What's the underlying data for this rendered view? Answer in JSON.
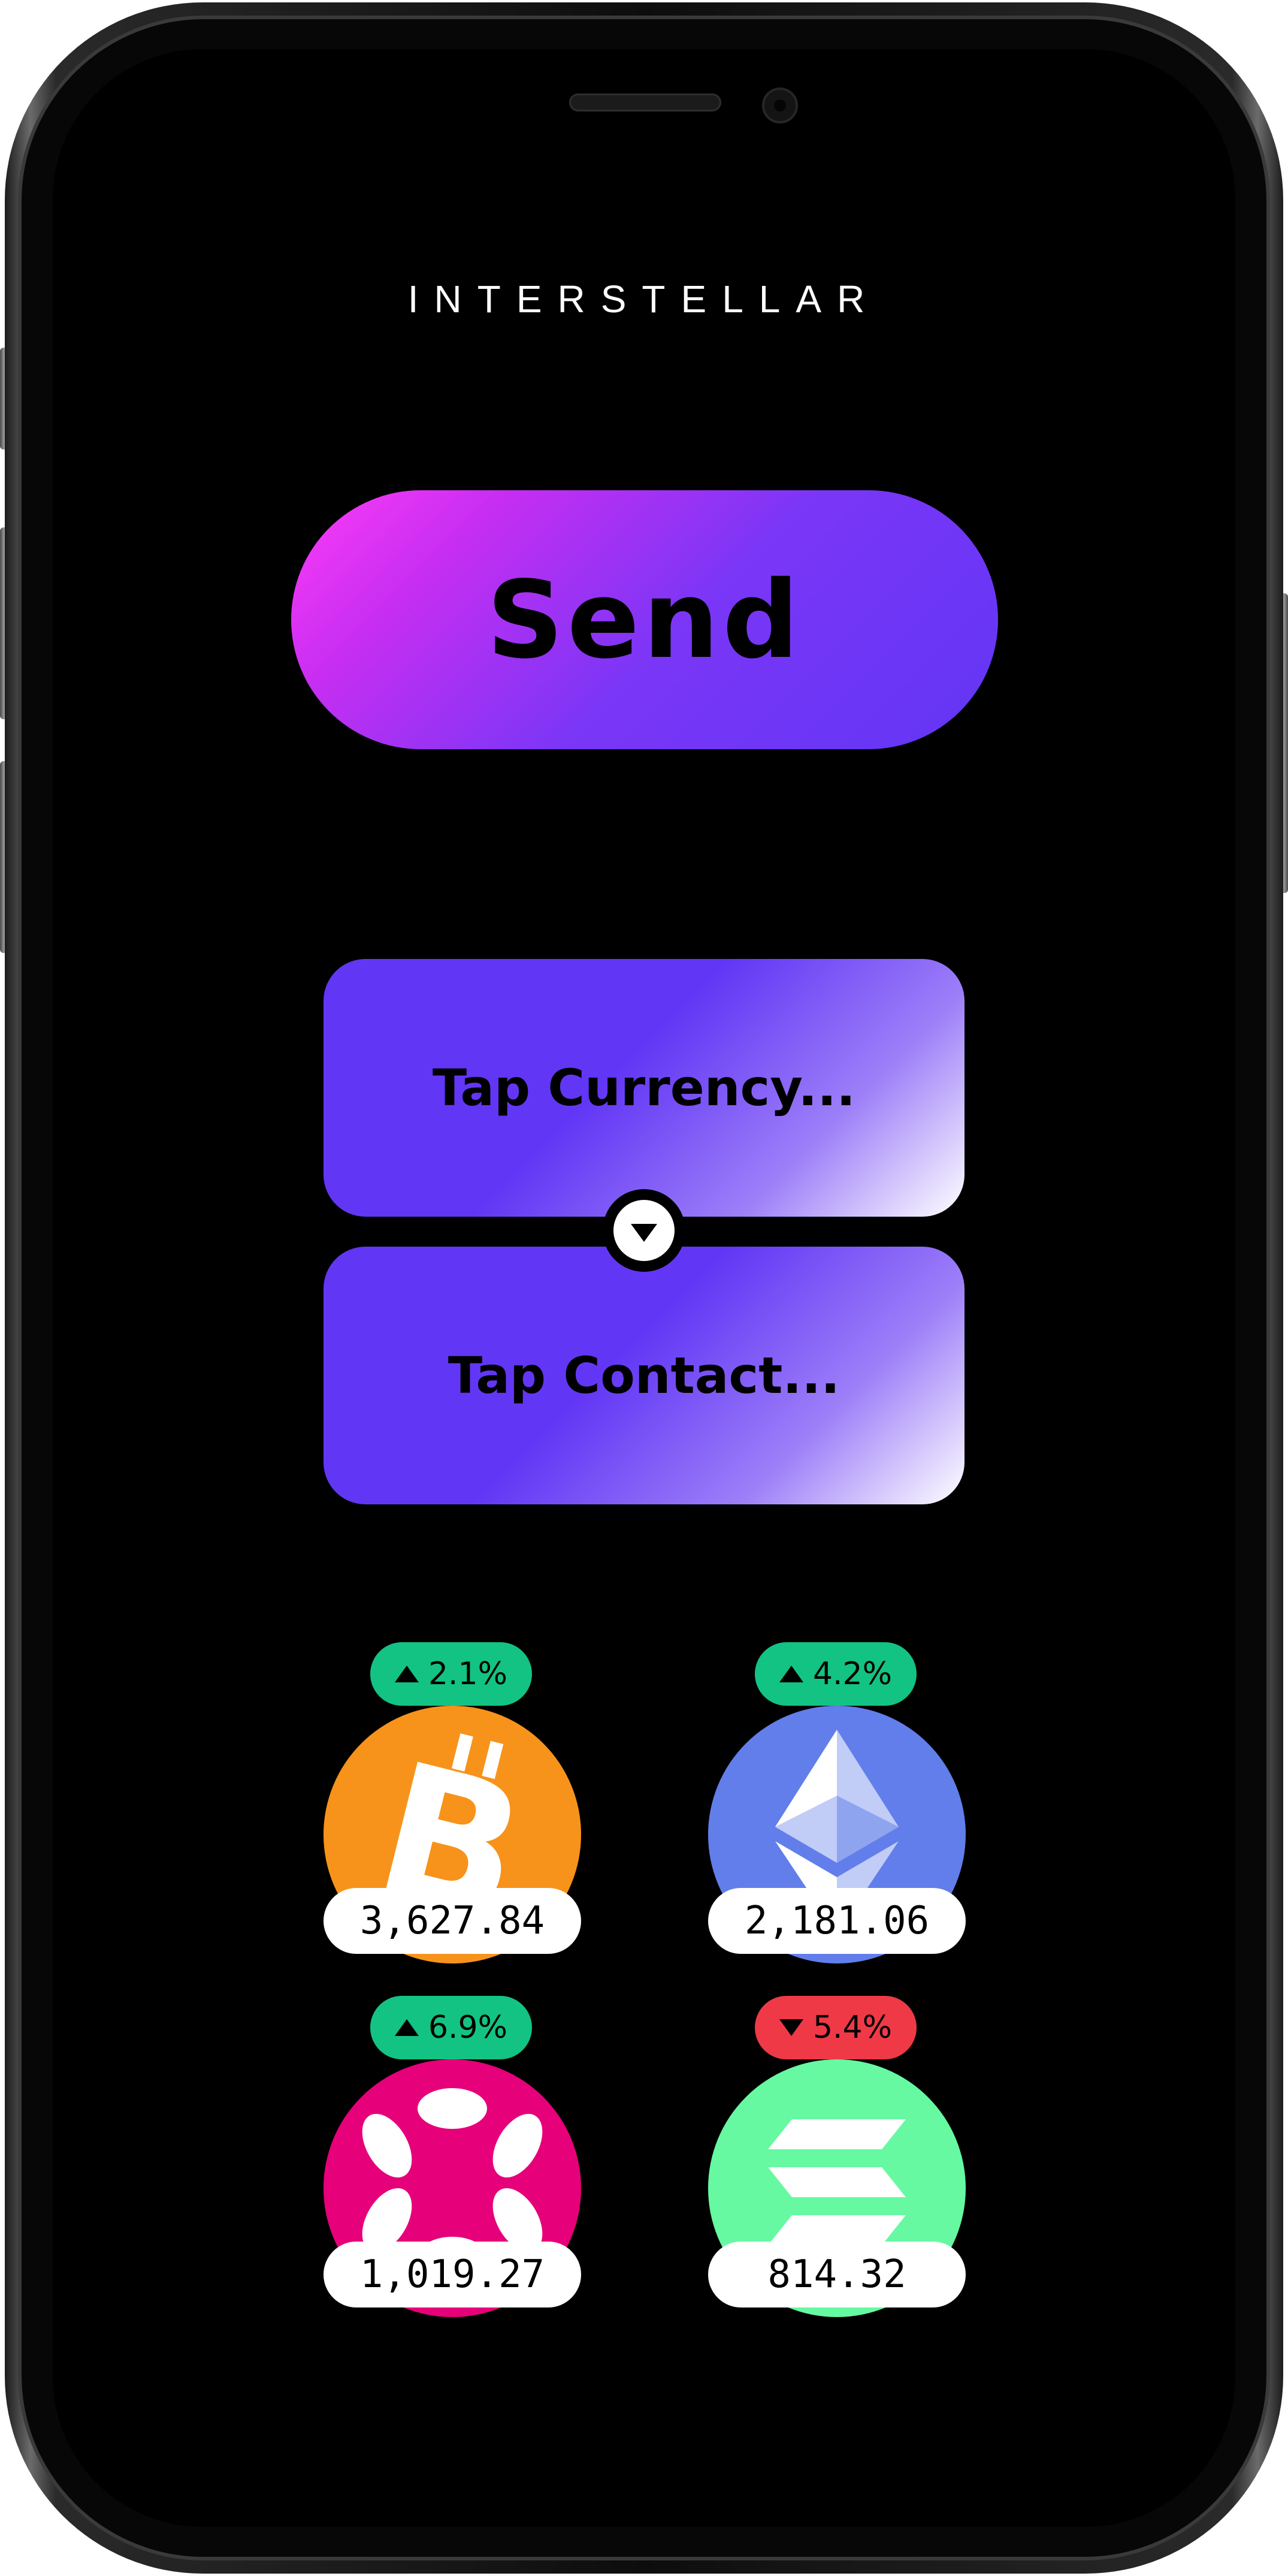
{
  "app": {
    "brand": "INTERSTELLAR"
  },
  "send": {
    "label": "Send"
  },
  "currency_field": {
    "label": "Tap Currency..."
  },
  "contact_field": {
    "label": "Tap Contact..."
  },
  "colors": {
    "accent": "#6236f5",
    "gradient_start": "#ff3cf7",
    "up": "#13c383",
    "down": "#ef3947",
    "btc": "#f7931a",
    "eth": "#627eea",
    "dot": "#e6007a",
    "sol": "#66f9a1"
  },
  "coins": [
    {
      "icon": "bitcoin-icon",
      "change": "2.1%",
      "direction": "up",
      "value": "3,627.84"
    },
    {
      "icon": "ethereum-icon",
      "change": "4.2%",
      "direction": "up",
      "value": "2,181.06"
    },
    {
      "icon": "polkadot-icon",
      "change": "6.9%",
      "direction": "up",
      "value": "1,019.27"
    },
    {
      "icon": "solana-icon",
      "change": "5.4%",
      "direction": "down",
      "value": "814.32"
    }
  ]
}
